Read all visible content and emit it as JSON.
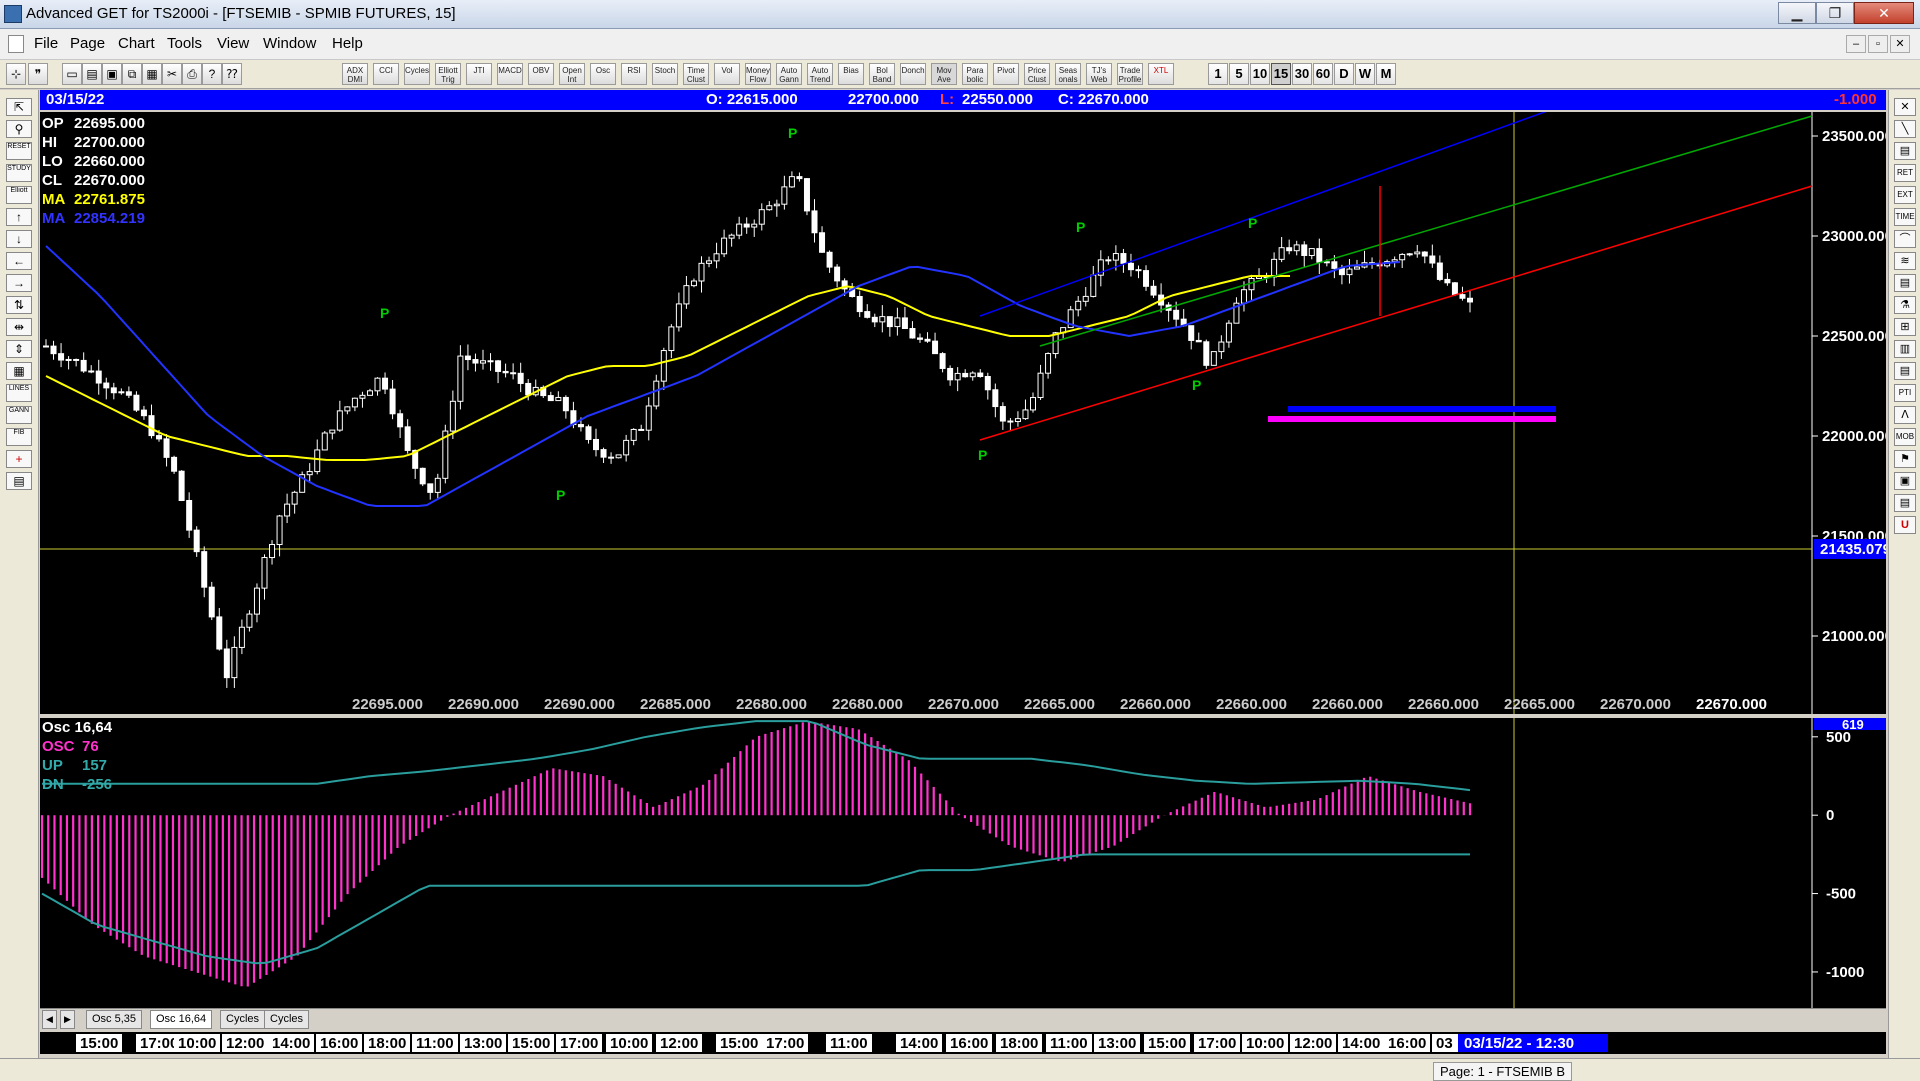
{
  "window": {
    "title": "Advanced GET for TS2000i - [FTSEMIB - SPMIB FUTURES, 15]",
    "minimize_glyph": "▁",
    "restore_glyph": "❐",
    "close_glyph": "✕"
  },
  "menu": [
    "File",
    "Page",
    "Chart",
    "Tools",
    "View",
    "Window",
    "Help"
  ],
  "mdi_buttons": [
    "–",
    "▫",
    "✕"
  ],
  "toolbar": {
    "file_icons": [
      "new-file-icon",
      "open-icon",
      "save-icon",
      "copy-icon",
      "paste-icon",
      "cut-icon",
      "print-icon",
      "help-icon",
      "whats-this-icon"
    ],
    "study_buttons": [
      "ADX DMI",
      "CCI",
      "Cycles",
      "Elliott Trig",
      "JTI",
      "MACD",
      "OBV",
      "Open Int",
      "Osc",
      "RSI",
      "Stoch",
      "Time Clust",
      "Vol",
      "Money Flow",
      "Auto Gann",
      "Auto Trend",
      "Bias",
      "Bol Band",
      "Donch",
      "Mov Ave",
      "Para bolic",
      "Pivot",
      "Price Clust",
      "Seas onals",
      "TJ's Web",
      "Trade Profile",
      "XTL"
    ],
    "timeframes": [
      "1",
      "5",
      "10",
      "15",
      "30",
      "60",
      "D",
      "W",
      "M"
    ],
    "active_timeframe": "15"
  },
  "left_tools": [
    "pointer-tool",
    "zoom-tool",
    "reset-tool",
    "study-tool",
    "elliott-tool",
    "arrow-up-tool",
    "arrow-down-tool",
    "arrow-left-tool",
    "arrow-right-tool",
    "fib-tool",
    "fib-ext-tool",
    "fib-time-tool",
    "grid-tool",
    "lines-tool",
    "gann-tool",
    "fib-fan-tool",
    "crosshair-tool",
    "report-tool"
  ],
  "left_tool_labels": [
    "",
    "",
    "RESET",
    "STUDY",
    "Elliott",
    "",
    "",
    "",
    "",
    "",
    "",
    "",
    "",
    "LINES",
    "GANN",
    "FIB",
    "",
    ""
  ],
  "right_tools": [
    "RET",
    "EXT",
    "TIME",
    "PTI",
    "MOB"
  ],
  "infobar": {
    "date": "03/15/22",
    "open": "O: 22615.000",
    "high": "22700.000",
    "low_label": "L:",
    "low": "22550.000",
    "close": "C: 22670.000",
    "change": "-1.000"
  },
  "price_legend": [
    {
      "label": "OP",
      "value": "22695.000",
      "color": "#ffffff"
    },
    {
      "label": "HI",
      "value": "22700.000",
      "color": "#ffffff"
    },
    {
      "label": "LO",
      "value": "22660.000",
      "color": "#ffffff"
    },
    {
      "label": "CL",
      "value": "22670.000",
      "color": "#ffffff"
    },
    {
      "label": "MA",
      "value": "22761.875",
      "color": "#ffff00"
    },
    {
      "label": "MA",
      "value": "22854.219",
      "color": "#3333ff"
    }
  ],
  "price_axis": {
    "ticks": [
      "23500.000",
      "23000.000",
      "22500.000",
      "22000.000",
      "21500.000",
      "21000.000"
    ],
    "tick_values": [
      23500,
      23000,
      22500,
      22000,
      21500,
      21000
    ],
    "min": 20700,
    "max": 23620,
    "cursor_value": "21435.079",
    "cursor_price": 21435
  },
  "bottom_price_row": [
    "22695.000",
    "22690.000",
    "22690.000",
    "22685.000",
    "22680.000",
    "22680.000",
    "22670.000",
    "22665.000",
    "22660.000",
    "22660.000",
    "22660.000",
    "22660.000",
    "22665.000",
    "22670.000"
  ],
  "bottom_price_last": "22670.000",
  "pivot_label": "P",
  "osc_legend": [
    {
      "label": "Osc 16,64",
      "value": "",
      "color": "#ffffff"
    },
    {
      "label": "OSC",
      "value": "76",
      "color": "#ff33cc"
    },
    {
      "label": "UP",
      "value": "157",
      "color": "#33aaaa"
    },
    {
      "label": "DN",
      "value": "-256",
      "color": "#33aaaa"
    }
  ],
  "osc_axis": {
    "ticks": [
      "500",
      "0",
      "-500",
      "-1000"
    ],
    "tick_values": [
      500,
      0,
      -500,
      -1000
    ],
    "min": -1230,
    "max": 620,
    "top_value": "619"
  },
  "osc_tabs": [
    "Osc 5,35",
    "Osc 16,64",
    "Cycles",
    "Cycles"
  ],
  "osc_active_tab": "Osc 16,64",
  "tab_nav": [
    "◀",
    "▶"
  ],
  "time_axis": [
    "15:00",
    "17:00",
    "10:00",
    "12:00",
    "14:00",
    "16:00",
    "18:00",
    "11:00",
    "13:00",
    "15:00",
    "17:00",
    "10:00",
    "12:00",
    "15:00",
    "17:00",
    "11:00",
    "14:00",
    "16:00",
    "18:00",
    "11:00",
    "13:00",
    "15:00",
    "17:00",
    "10:00",
    "12:00",
    "14:00",
    "16:00",
    "03"
  ],
  "time_cursor": "03/15/22 - 12:30",
  "statusbar": {
    "page": "Page: 1 - FTSEMIB B"
  },
  "colors": {
    "background": "#000000",
    "candle": "#ffffff",
    "ma_fast": "#ffff00",
    "ma_slow": "#2233ff",
    "channel_top": "#0000ff",
    "channel_mid": "#00aa00",
    "channel_bottom": "#ff0000",
    "pivot": "#00cc00",
    "osc": "#ff33cc",
    "bands": "#2a9d9d",
    "cursor_line": "#cccc33",
    "axis_box": "#0000ff"
  },
  "chart_data": {
    "type": "line",
    "title": "",
    "series": [
      {
        "name": "",
        "values": [
          22450,
          22380,
          22300,
          22200,
          22050,
          21800,
          21300,
          20800,
          21200,
          21600,
          21800,
          22050,
          22200,
          22300,
          21900,
          21700,
          22400,
          22350,
          22300,
          22200,
          22150,
          21950,
          21900,
          22050,
          22500,
          22800,
          22950,
          23050,
          23150,
          23300,
          22900,
          22700,
          22600,
          22550,
          22450,
          22300,
          22350,
          22050,
          22150,
          22500,
          22700,
          22900,
          22850,
          22700,
          22550,
          22350,
          22700,
          22800,
          22950,
          22900,
          22800,
          22850,
          22900,
          22950,
          22750,
          22650
        ]
      },
      {
        "name": "MA",
        "values": [
          22300,
          22200,
          22100,
          22000,
          21950,
          21900,
          21900,
          21880,
          21880,
          21900,
          22000,
          22100,
          22200,
          22300,
          22350,
          22350,
          22400,
          22500,
          22600,
          22700,
          22750,
          22700,
          22600,
          22550,
          22500,
          22500,
          22550,
          22600,
          22700,
          22750,
          22800,
          22800
        ]
      },
      {
        "name": "MA",
        "values": [
          22950,
          22700,
          22400,
          22100,
          21900,
          21750,
          21650,
          21650,
          21800,
          21950,
          22100,
          22200,
          22300,
          22450,
          22600,
          22750,
          22850,
          22800,
          22650,
          22550,
          22500,
          22550,
          22650,
          22750,
          22850,
          22870
        ]
      },
      {
        "name": "OSC",
        "values": [
          -400,
          -700,
          -900,
          -1000,
          -1100,
          -900,
          -500,
          -200,
          0,
          150,
          300,
          250,
          50,
          200,
          500,
          600,
          550,
          350,
          0,
          -200,
          -300,
          -200,
          0,
          150,
          50,
          100,
          250,
          150,
          76
        ]
      }
    ],
    "pivots": [
      22550,
      21750,
      23450,
      21950,
      22980,
      22300,
      23000
    ],
    "ylim": [
      20700,
      23620
    ]
  }
}
